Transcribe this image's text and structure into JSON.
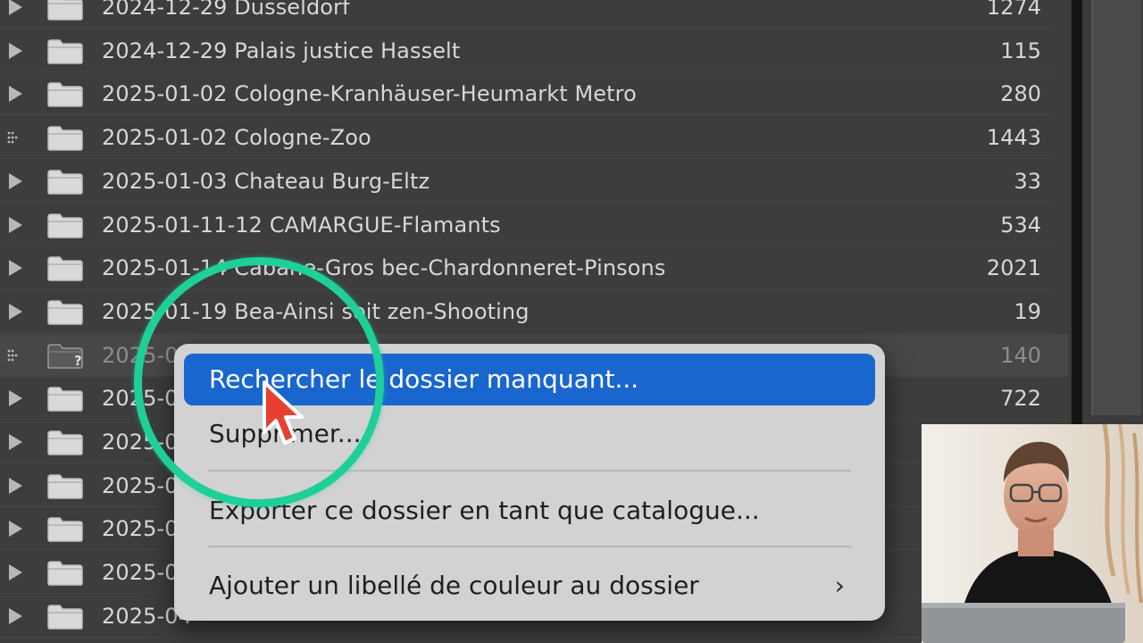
{
  "folders": [
    {
      "name": "2024-12-29 Dusseldorf",
      "count": "1274",
      "expander": "arrow"
    },
    {
      "name": "2024-12-29 Palais justice Hasselt",
      "count": "115",
      "expander": "arrow"
    },
    {
      "name": "2025-01-02 Cologne-Kranhäuser-Heumarkt Metro",
      "count": "280",
      "expander": "arrow"
    },
    {
      "name": "2025-01-02 Cologne-Zoo",
      "count": "1443",
      "expander": "dots"
    },
    {
      "name": "2025-01-03 Chateau Burg-Eltz",
      "count": "33",
      "expander": "arrow"
    },
    {
      "name": "2025-01-11-12 CAMARGUE-Flamants",
      "count": "534",
      "expander": "arrow"
    },
    {
      "name": "2025-01-14 Cabane-Gros bec-Chardonneret-Pinsons",
      "count": "2021",
      "expander": "arrow"
    },
    {
      "name": "2025-01-19 Bea-Ainsi soit zen-Shooting",
      "count": "19",
      "expander": "arrow"
    },
    {
      "name": "2025-0",
      "count": "140",
      "expander": "dots",
      "missing": true
    },
    {
      "name": "2025-0",
      "count": "722",
      "expander": "arrow"
    },
    {
      "name": "2025-0",
      "count": "",
      "expander": "arrow"
    },
    {
      "name": "2025-0",
      "count": "",
      "expander": "arrow"
    },
    {
      "name": "2025-0",
      "count": "",
      "expander": "arrow"
    },
    {
      "name": "2025-0",
      "count": "",
      "expander": "arrow"
    },
    {
      "name": "2025-04",
      "count": "",
      "expander": "arrow"
    }
  ],
  "missing_marker": "?",
  "context_menu": {
    "items": [
      {
        "label": "Rechercher le dossier manquant...",
        "highlighted": true
      },
      {
        "label": "Supprimer...",
        "highlighted": false
      },
      {
        "label": "Exporter ce dossier en tant que catalogue...",
        "highlighted": false
      },
      {
        "label": "Ajouter un libellé de couleur au dossier",
        "highlighted": false,
        "submenu": true
      }
    ],
    "submenu_glyph": "›"
  },
  "colors": {
    "menu_highlight": "#1a66cf",
    "focus_ring": "#1fcf9a",
    "cursor": "#e8402e"
  },
  "icons": [
    "disclosure-arrow-icon",
    "stacked-dots-icon",
    "folder-icon",
    "missing-folder-icon",
    "submenu-chevron-icon",
    "mouse-cursor-icon"
  ]
}
